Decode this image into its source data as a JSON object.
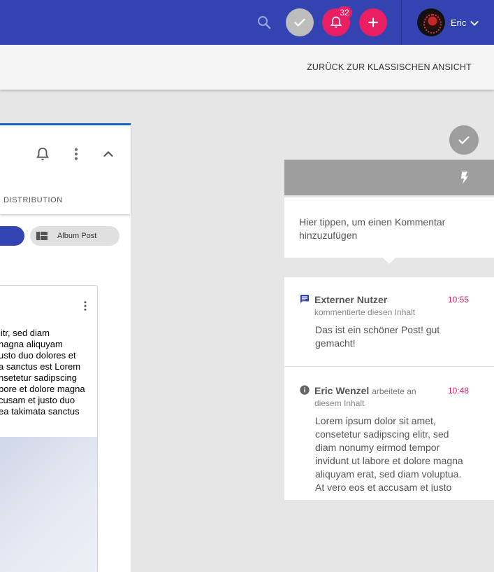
{
  "topbar": {
    "notification_count": "32",
    "user_name": "Eric",
    "colors": {
      "primary": "#3344b2",
      "accent": "#e91e63"
    },
    "icons": [
      "search-icon",
      "check-icon",
      "bell-icon",
      "plus-icon",
      "chevron-down-icon"
    ]
  },
  "subbar": {
    "back_link": "ZURÜCK ZUR KLASSISCHEN ANSICHT"
  },
  "left_panel": {
    "tab_label": "DISTRIBUTION",
    "chip_album": "Album Post",
    "post_lines": [
      "litr, sed diam",
      "nagna aliquyam",
      "usto duo dolores et",
      "a sanctus est Lorem",
      "nsetetur sadipscing",
      "bore et dolore magna",
      "cusam et justo duo",
      "ea takimata sanctus"
    ]
  },
  "right_panel": {
    "comment_placeholder": "Hier tippen, um einen Kommentar hinzuzufügen",
    "activities": [
      {
        "icon": "comment-icon",
        "author": "Externer Nutzer",
        "action": "",
        "subline": "kommentierte diesen Inhalt",
        "time": "10:55",
        "text": "Das ist ein schöner Post! gut gemacht!"
      },
      {
        "icon": "info-icon",
        "author": "Eric Wenzel",
        "action": "arbeitete an",
        "subline": "diesem Inhalt",
        "time": "10:48",
        "text": "Lorem ipsum dolor sit amet, consetetur sadipscing elitr, sed diam nonumy eirmod tempor invidunt ut labore et dolore magna aliquyam erat, sed diam voluptua. At vero eos et accusam et justo"
      }
    ]
  }
}
